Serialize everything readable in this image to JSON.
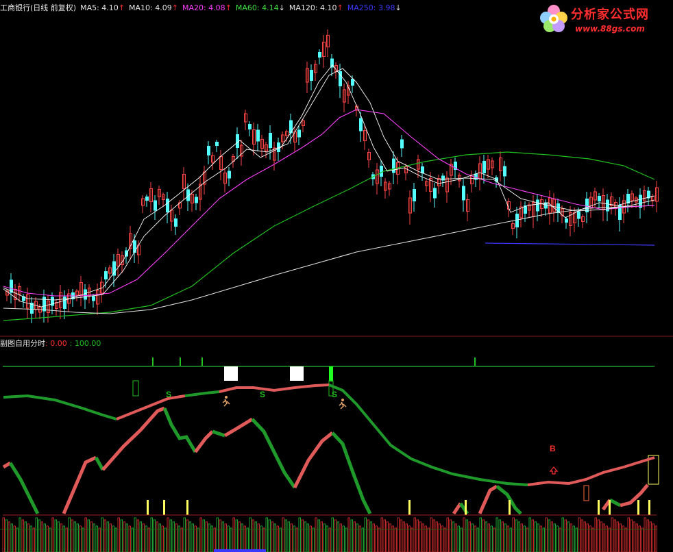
{
  "header": {
    "stock": "工商银行(日线 前复权)",
    "ma": [
      {
        "label": "MA5: 4.10",
        "arrow": "↑",
        "color": "#e6e6e6",
        "arrow_color": "#ff3030"
      },
      {
        "label": "MA10: 4.09",
        "arrow": "↑",
        "color": "#e6e6e6",
        "arrow_color": "#ff3030"
      },
      {
        "label": "MA20: 4.08",
        "arrow": "↑",
        "color": "#ff40ff",
        "arrow_color": "#ff3030"
      },
      {
        "label": "MA60: 4.14",
        "arrow": "↓",
        "color": "#40e040",
        "arrow_color": "#e6e6e6"
      },
      {
        "label": "MA120: 4.10",
        "arrow": "↑",
        "color": "#e6e6e6",
        "arrow_color": "#ff3030"
      },
      {
        "label": "MA250: 3.98",
        "arrow": "↓",
        "color": "#3a3aff",
        "arrow_color": "#e6e6e6"
      }
    ]
  },
  "sub_header": {
    "title": "副图自用分时",
    "v1": ": 0.00",
    "v2": ": 100.00"
  },
  "logo": {
    "title": "分析家公式网",
    "url": "www.88gs.com"
  },
  "signals": {
    "s_labels": [
      "S",
      "S",
      "S"
    ],
    "b_label": "B"
  },
  "colors": {
    "up": "#ff4444",
    "down": "#54ffff",
    "ma5": "#ffffff",
    "ma20": "#ff40ff",
    "ma60": "#20c020",
    "ma250": "#3a3aff",
    "green_band": "#1f9a2a",
    "red_band": "#e05a5a",
    "yellow": "#ffff60"
  }
}
